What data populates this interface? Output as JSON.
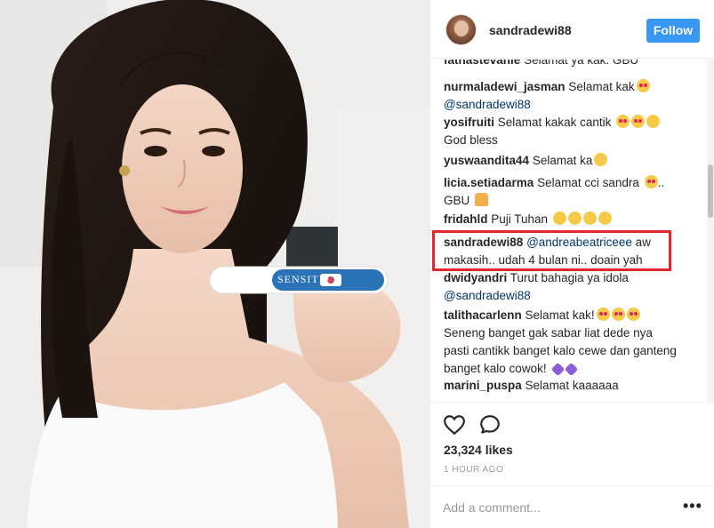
{
  "post": {
    "username": "sandradewi88",
    "follow_label": "Follow",
    "likes": "23,324 likes",
    "time": "1 HOUR AGO",
    "add_comment_placeholder": "Add a comment...",
    "more_label": "•••",
    "product_label": "SENSITIF"
  },
  "comments": [
    {
      "user": "fathastevanie",
      "text": "Selamat ya kak. GBU",
      "emoji": []
    },
    {
      "user": "nurmaladewi_jasman",
      "text": "Selamat kak",
      "emoji": [
        "heart-eyes-icon"
      ],
      "mention": "@sandradewi88"
    },
    {
      "user": "yosifruiti",
      "text": "Selamat kakak cantik",
      "emoji": [
        "heart-eyes-icon",
        "heart-eyes-icon",
        "kiss-icon"
      ],
      "text2": "God bless"
    },
    {
      "user": "yuswaandita44",
      "text": "Selamat ka",
      "emoji": [
        "grin-icon"
      ]
    },
    {
      "user": "licia.setiadarma",
      "text": "Selamat cci sandra",
      "emoji": [
        "heart-eyes-icon"
      ],
      "text_after": "..",
      "text2": "GBU",
      "emoji2": [
        "pray-icon"
      ]
    },
    {
      "user": "fridahld",
      "text": "Puji Tuhan",
      "emoji": [
        "laugh-icon",
        "laugh-icon",
        "laugh-icon",
        "laugh-icon"
      ]
    },
    {
      "user": "sandradewi88",
      "mention": "@andreabeatriceee",
      "text": "aw",
      "text2": "makasih.. udah 4 bulan ni.. doain yah"
    },
    {
      "user": "dwidyandri",
      "text": "Turut bahagia ya idola",
      "mention": "@sandradewi88"
    },
    {
      "user": "talithacarlenn",
      "text": "Selamat kak!",
      "emoji": [
        "heart-eyes-icon",
        "heart-eyes-icon",
        "heart-eyes-icon"
      ],
      "text2": "Seneng banget gak sabar liat dede nya",
      "text3": "pasti cantikk banget kalo cewe dan ganteng",
      "text4": "banget kalo cowok!",
      "emoji4": [
        "purple-heart-icon",
        "purple-heart-icon"
      ]
    },
    {
      "user": "marini_puspa",
      "text": "Selamat kaaaaaa",
      "emoji": []
    }
  ],
  "colors": {
    "accent": "#3897f0",
    "highlight": "#e3262e",
    "mention": "#003569"
  }
}
